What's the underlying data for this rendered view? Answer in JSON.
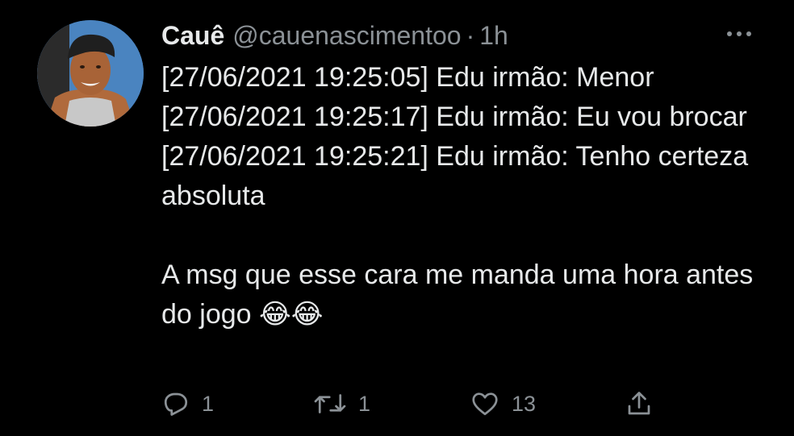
{
  "tweet": {
    "author": {
      "display_name": "Cauê",
      "handle": "@cauenascimentoo",
      "separator": "·",
      "time": "1h"
    },
    "lines": [
      "[27/06/2021 19:25:05] Edu irmão: Menor",
      "[27/06/2021 19:25:17] Edu irmão: Eu vou brocar",
      "[27/06/2021 19:25:21] Edu irmão: Tenho certeza absoluta"
    ],
    "caption": "A msg que esse cara me manda uma hora antes do jogo 😂😂"
  },
  "actions": {
    "reply": {
      "icon": "reply-icon",
      "count": "1"
    },
    "retweet": {
      "icon": "retweet-icon",
      "count": "1"
    },
    "like": {
      "icon": "heart-icon",
      "count": "13"
    },
    "share": {
      "icon": "share-icon"
    }
  },
  "colors": {
    "background": "#000000",
    "text": "#e7e9ea",
    "secondary": "#8b9196"
  }
}
